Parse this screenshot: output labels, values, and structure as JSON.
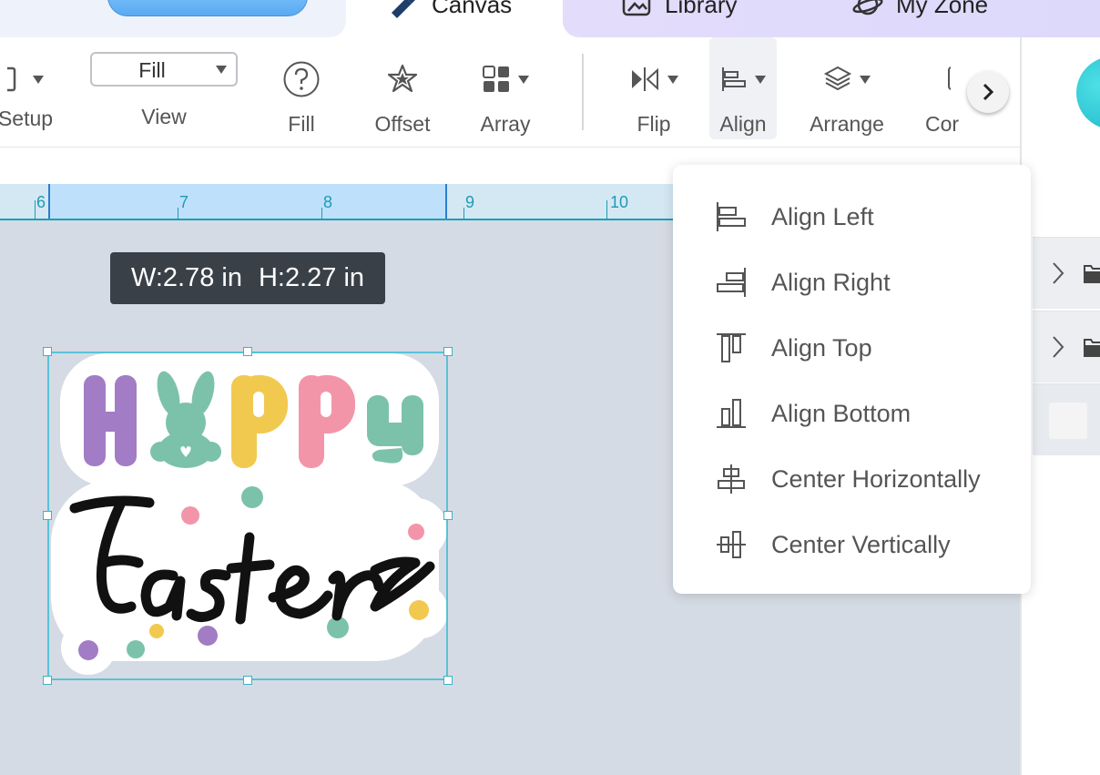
{
  "tabs": {
    "canvas": "Canvas",
    "library": "Library",
    "myzone": "My Zone"
  },
  "toolbar": {
    "setup_label": "Setup",
    "view_select_value": "Fill",
    "view_label": "View",
    "fill_label": "Fill",
    "offset_label": "Offset",
    "array_label": "Array",
    "flip_label": "Flip",
    "align_label": "Align",
    "arrange_label": "Arrange",
    "combine_label_partial": "Cor"
  },
  "ruler": {
    "ticks": [
      "6",
      "7",
      "8",
      "9",
      "10"
    ]
  },
  "dimension_tooltip": {
    "width": "W:2.78 in",
    "height": "H:2.27 in"
  },
  "artwork": {
    "line1": "HAPPY",
    "line2": "Easter"
  },
  "align_menu": {
    "items": [
      {
        "label": "Align Left",
        "icon": "align-left-icon"
      },
      {
        "label": "Align Right",
        "icon": "align-right-icon"
      },
      {
        "label": "Align Top",
        "icon": "align-top-icon"
      },
      {
        "label": "Align Bottom",
        "icon": "align-bottom-icon"
      },
      {
        "label": "Center Horizontally",
        "icon": "center-horizontally-icon"
      },
      {
        "label": "Center Vertically",
        "icon": "center-vertically-icon"
      }
    ]
  },
  "colors": {
    "accent": "#58c2d6",
    "purple": "#a27cc4",
    "mint": "#7cc2ab",
    "yellow": "#f1c94f",
    "pink": "#f395a9"
  }
}
